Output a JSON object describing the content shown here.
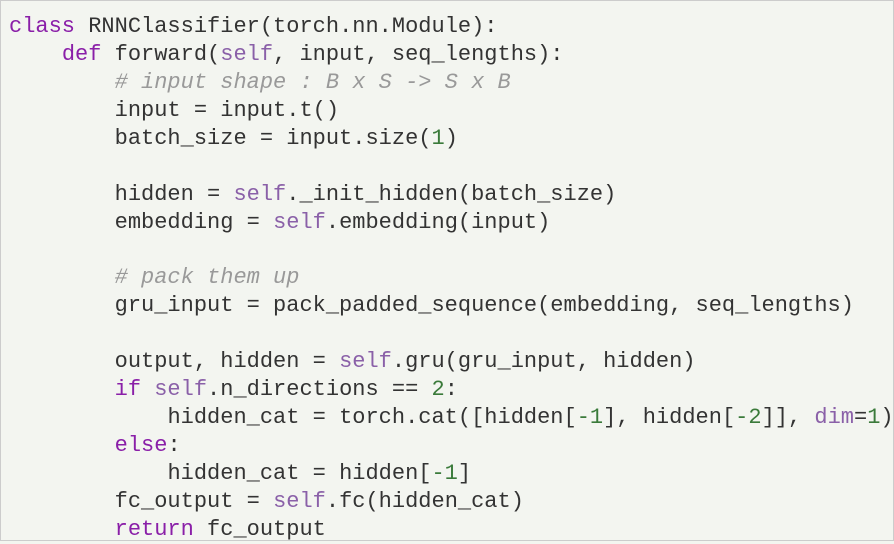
{
  "code": {
    "class_kw": "class",
    "class_name": " RNNClassifier",
    "class_base": "(torch.nn.Module):",
    "def_kw": "def",
    "fn_name": " forward",
    "fn_params_open": "(",
    "self": "self",
    "fn_params_rest": ", input, seq_lengths):",
    "comment1": "# input shape : B x S -> S x B",
    "line_input_t": "input = input.t()",
    "line_batch_pre": "batch_size = input.size(",
    "num_1": "1",
    "line_batch_post": ")",
    "line_hidden_pre": "hidden = ",
    "line_hidden_post": "._init_hidden(batch_size)",
    "line_embed_pre": "embedding = ",
    "line_embed_post": ".embedding(input)",
    "comment2": "# pack them up",
    "line_gru_input": "gru_input = pack_padded_sequence(embedding, seq_lengths)",
    "line_output_pre": "output, hidden = ",
    "line_output_post": ".gru(gru_input, hidden)",
    "if_kw": "if",
    "if_pre": " ",
    "if_mid": ".n_directions == ",
    "num_2": "2",
    "if_post": ":",
    "line_cat_pre": "hidden_cat = torch.cat([hidden[",
    "num_m1a": "-1",
    "line_cat_mid1": "], hidden[",
    "num_m2": "-2",
    "line_cat_mid2": "]], ",
    "dim_kw": "dim",
    "line_cat_eq": "=",
    "num_1b": "1",
    "line_cat_post": ")",
    "else_kw": "else",
    "else_colon": ":",
    "line_else_pre": "hidden_cat = hidden[",
    "num_m1b": "-1",
    "line_else_post": "]",
    "line_fc_pre": "fc_output = ",
    "line_fc_post": ".fc(hidden_cat)",
    "return_kw": "return",
    "return_val": " fc_output"
  }
}
